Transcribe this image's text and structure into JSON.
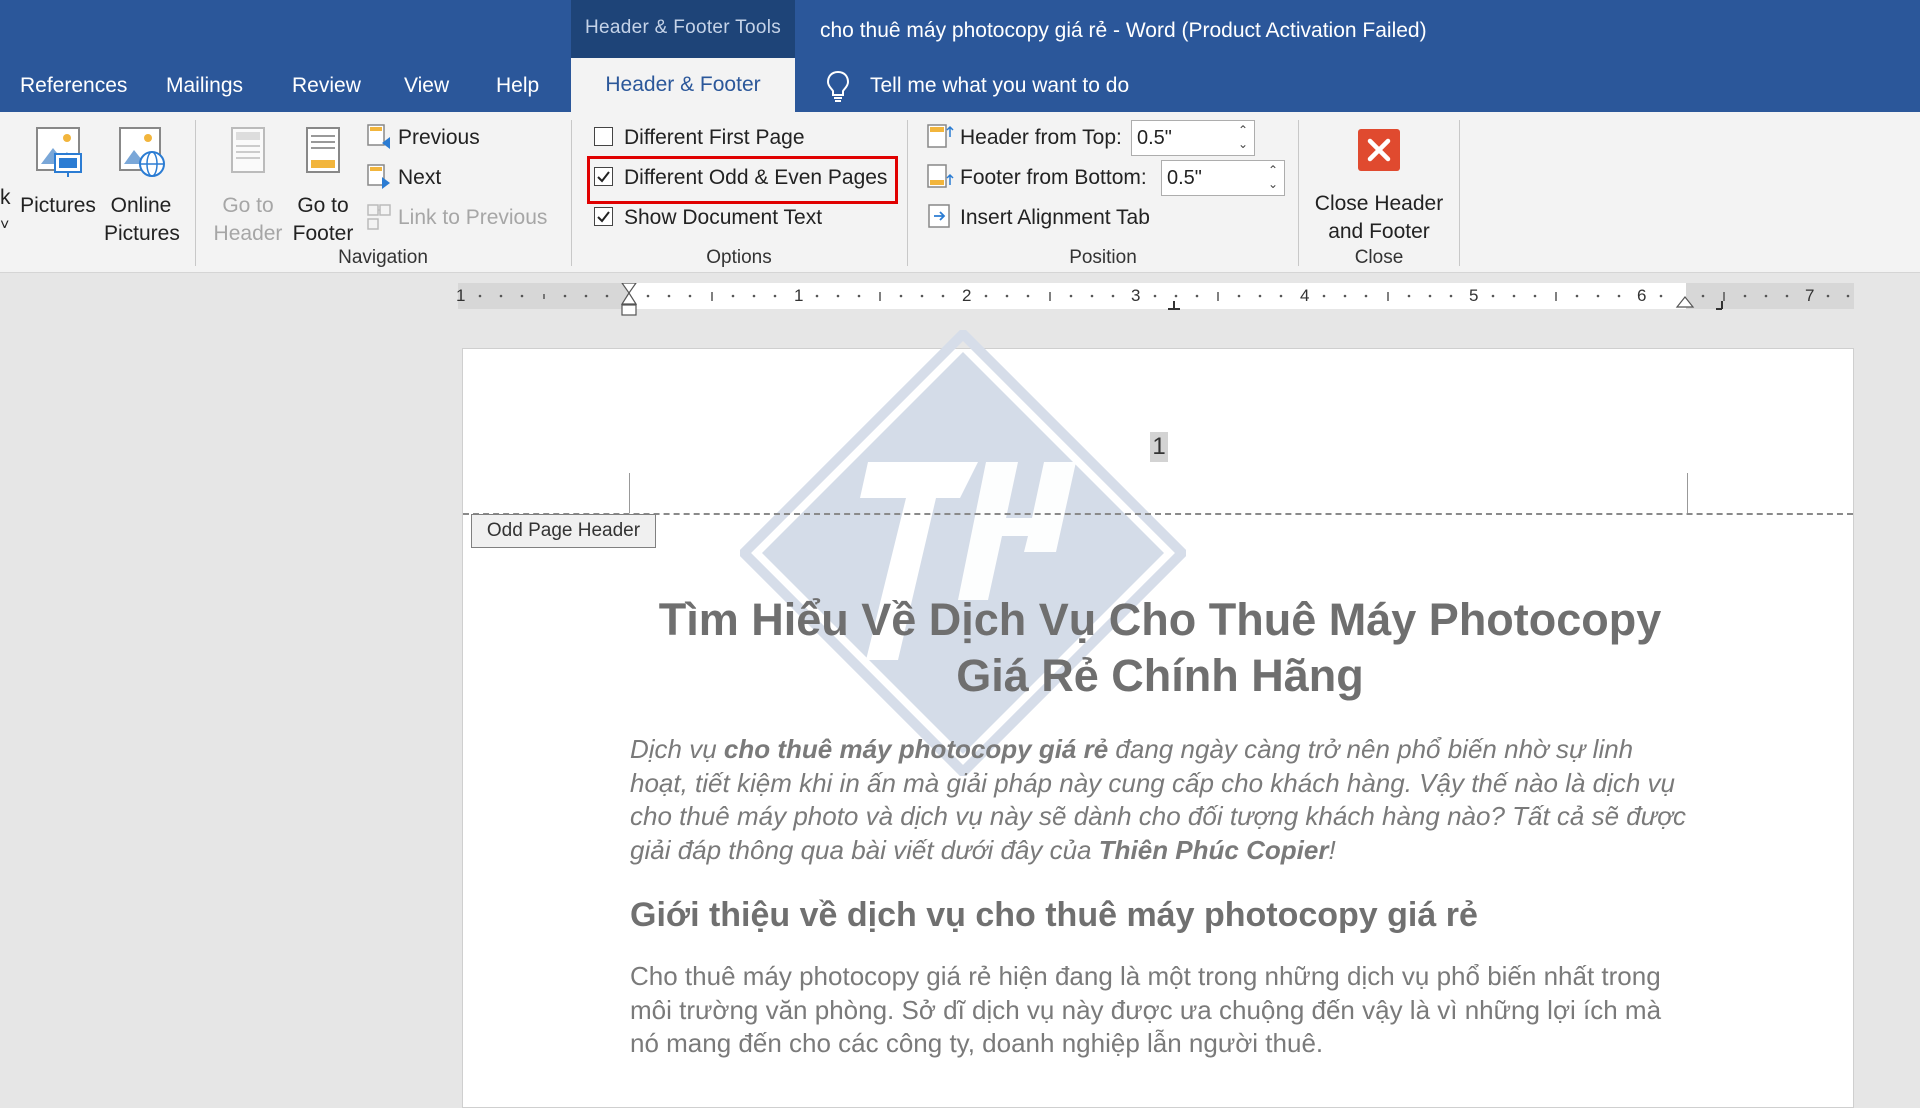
{
  "window": {
    "context_group": "Header & Footer Tools",
    "title": "cho thuê máy photocopy giá rẻ  -  Word (Product Activation Failed)"
  },
  "tabs": [
    {
      "label": "References"
    },
    {
      "label": "Mailings"
    },
    {
      "label": "Review"
    },
    {
      "label": "View"
    },
    {
      "label": "Help"
    },
    {
      "label": "Header & Footer",
      "active": true
    }
  ],
  "tell_me": "Tell me what you want to do",
  "ribbon": {
    "insert_partial": {
      "label_char": "k",
      "chevron": "˅"
    },
    "pictures": {
      "label": "Pictures"
    },
    "online_pictures": {
      "line1": "Online",
      "line2": "Pictures"
    },
    "navigation": {
      "go_to_header": {
        "line1": "Go to",
        "line2": "Header",
        "enabled": false
      },
      "go_to_footer": {
        "line1": "Go to",
        "line2": "Footer"
      },
      "previous": "Previous",
      "next": "Next",
      "link_to_previous": {
        "label": "Link to Previous",
        "enabled": false
      },
      "group_label": "Navigation"
    },
    "options": {
      "different_first_page": {
        "label": "Different First Page",
        "checked": false
      },
      "different_odd_even": {
        "label": "Different Odd & Even Pages",
        "checked": true
      },
      "show_document_text": {
        "label": "Show Document Text",
        "checked": true
      },
      "group_label": "Options"
    },
    "position": {
      "header_from_top": {
        "label": "Header from Top:",
        "value": "0.5\""
      },
      "footer_from_bottom": {
        "label": "Footer from Bottom:",
        "value": "0.5\""
      },
      "insert_alignment_tab": "Insert Alignment Tab",
      "group_label": "Position"
    },
    "close": {
      "line1": "Close Header",
      "line2": "and Footer",
      "group_label": "Close"
    }
  },
  "ruler": {
    "numbers": [
      "1",
      "1",
      "2",
      "3",
      "4",
      "5",
      "6",
      "7"
    ]
  },
  "document": {
    "header_tag": "Odd Page Header",
    "page_number": "1",
    "title": "Tìm Hiểu Về Dịch Vụ Cho Thuê Máy Photocopy Giá Rẻ Chính Hãng",
    "intro": {
      "part1": "Dịch vụ ",
      "bold1": "cho thuê máy photocopy giá rẻ",
      "part2": " đang ngày càng trở nên phổ biến nhờ sự linh hoạt, tiết kiệm khi in ấn mà giải pháp này cung cấp cho khách hàng. Vậy thế nào là dịch vụ cho thuê máy photo và dịch vụ này sẽ dành cho đối tượng khách hàng nào? Tất cả sẽ được giải đáp thông qua bài viết dưới đây của ",
      "bold2": "Thiên Phúc Copier",
      "part3": "!"
    },
    "heading2": "Giới thiệu về dịch vụ cho thuê máy photocopy giá rẻ",
    "body": "Cho thuê máy photocopy giá rẻ hiện đang là một trong những dịch vụ phổ biến nhất trong môi trường văn phòng. Sở dĩ dịch vụ này được ưa chuộng đến vậy là vì những lợi ích mà nó mang đến cho các công ty, doanh nghiệp lẫn người thuê."
  },
  "colors": {
    "titlebar": "#2b579a",
    "context": "#1e4478",
    "highlight": "#e00000",
    "close_icon": "#e04a2f"
  }
}
